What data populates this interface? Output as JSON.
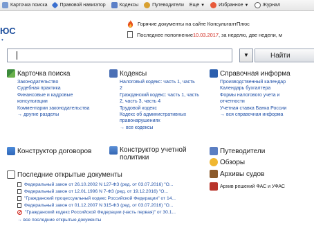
{
  "toolbar": {
    "items": [
      {
        "label": "Карточка поиска",
        "icon": "search-card-icon"
      },
      {
        "label": "Правовой навигатор",
        "icon": "navigator-icon"
      },
      {
        "label": "Кодексы",
        "icon": "codes-icon"
      },
      {
        "label": "Путеводители",
        "icon": "guides-icon"
      },
      {
        "label": "Еще",
        "icon": "more-icon"
      },
      {
        "label": "Избранное",
        "icon": "favorites-icon"
      },
      {
        "label": "Журнал",
        "icon": "journal-icon"
      }
    ]
  },
  "brand": {
    "text": "ЮС"
  },
  "news": {
    "hot_label": "Горячие документы на сайте КонсультантПлюс",
    "update_prefix": "Последнее пополнение ",
    "update_date": "10.03.2017",
    "update_suffix": ", за неделю, две недели, м"
  },
  "search": {
    "value": "",
    "button_label": "Найти"
  },
  "sections": {
    "search_card": {
      "title": "Карточка поиска",
      "links": [
        "Законодательство",
        "Судебная практика",
        "Финансовые и кадровые консультации",
        "Комментарии законодательства"
      ],
      "more": "→ другие разделы"
    },
    "codes": {
      "title": "Кодексы",
      "links": [
        "Налоговый кодекс: часть 1, часть 2",
        "Гражданский кодекс: часть 1, часть 2, часть 3, часть 4",
        "Трудовой кодекс",
        "Кодекс об административных правонарушениях"
      ],
      "more": "→ все кодексы"
    },
    "reference": {
      "title": "Справочная информа",
      "links": [
        "Производственный календар",
        "Календарь бухгалтера",
        "Формы налогового учета и отчетности",
        "Учетная ставка Банка России"
      ],
      "more": "→ вся справочная информа"
    },
    "contracts": {
      "title": "Конструктор договоров"
    },
    "accounting": {
      "title": "Конструктор учетной политики"
    },
    "guides": {
      "title": "Путеводители"
    },
    "reviews": {
      "title": "Обзоры"
    },
    "courts": {
      "title": "Архивы судов"
    },
    "fas": {
      "title": "Архив решений ФАС и УФАС"
    },
    "recent": {
      "title": "Последние открытые документы",
      "items": [
        "Федеральный закон от 26.10.2002 N 127-ФЗ (ред. от 03.07.2016) \"О...",
        "Федеральный закон от 12.01.1996 N 7-ФЗ (ред. от 19.12.2016) \"О...",
        "\"Гражданский процессуальный кодекс Российской Федерации\" от 14...",
        "Федеральный закон от 01.12.2007 N 315-ФЗ (ред. от 03.07.2016) \"О...",
        "\"Гражданский кодекс Российской Федерации (часть первая)\" от 30.1..."
      ],
      "more": "→ все последние открытые документы"
    }
  },
  "colors": {
    "link": "#1d4ea6",
    "accent_red": "#d0261c",
    "brand": "#1c4d9c"
  }
}
